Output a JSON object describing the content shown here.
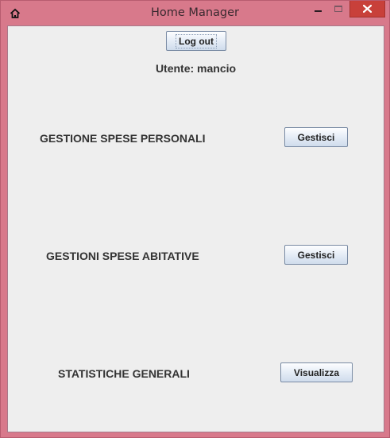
{
  "window": {
    "title": "Home Manager",
    "icon": "home-icon",
    "controls": {
      "minimize": "minimize-icon",
      "maximize": "maximize-icon",
      "close": "close-icon"
    },
    "colors": {
      "frame": "#d8798b",
      "close": "#c8403a",
      "client": "#eeeeee"
    }
  },
  "header": {
    "logout_label": "Log out",
    "user_label": "Utente: mancio"
  },
  "sections": [
    {
      "label": "GESTIONE SPESE PERSONALI",
      "button": "Gestisci"
    },
    {
      "label": "GESTIONI SPESE ABITATIVE",
      "button": "Gestisci"
    },
    {
      "label": "STATISTICHE GENERALI",
      "button": "Visualizza"
    }
  ]
}
